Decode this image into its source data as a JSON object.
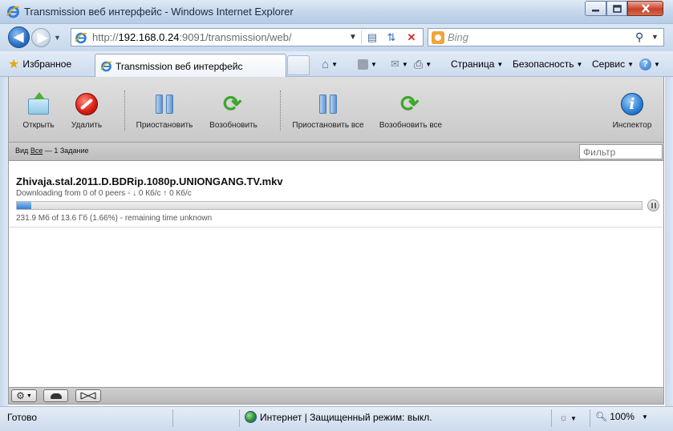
{
  "window": {
    "title": "Transmission веб интерфейс - Windows Internet Explorer"
  },
  "addressbar": {
    "url_prefix": "http://",
    "url_host": "192.168.0.24",
    "url_rest": ":9091/transmission/web/",
    "search_placeholder": "Bing"
  },
  "commandbar": {
    "favorites_label": "Избранное",
    "tab_label": "Transmission веб интерфейс",
    "page_menu": "Страница",
    "safety_menu": "Безопасность",
    "tools_menu": "Сервис",
    "help_icon": "?"
  },
  "toolbar": {
    "open_label": "Открыть",
    "remove_label": "Удалить",
    "pause_label": "Приостановить",
    "resume_label": "Возобновить",
    "pause_all_label": "Приостановить все",
    "resume_all_label": "Возобновить все",
    "inspector_label": "Инспектор"
  },
  "filterbar": {
    "view_prefix": "Вид",
    "view_all": "Все",
    "count_text": "— 1 Задание",
    "filter_placeholder": "Фильтр"
  },
  "torrents": [
    {
      "name": "Zhivaja.stal.2011.D.BDRip.1080p.UNIONGANG.TV.mkv",
      "peers": "Downloading from 0 of 0 peers - ↓ 0 Кб/с ↑ 0 Кб/с",
      "progress_fraction": 0.0166,
      "progress_text": "231.9 Мб of 13.6 Гб (1.66%) - remaining time unknown"
    }
  ],
  "statusbar": {
    "ready_text": "Готово",
    "zone_text": "Интернет | Защищенный режим: выкл.",
    "zoom_text": "100%"
  },
  "colors": {
    "progress_fill": "#2f7fd6",
    "toolbar_bg": "#d4d4d4",
    "ie_chrome": "#cddbec"
  }
}
